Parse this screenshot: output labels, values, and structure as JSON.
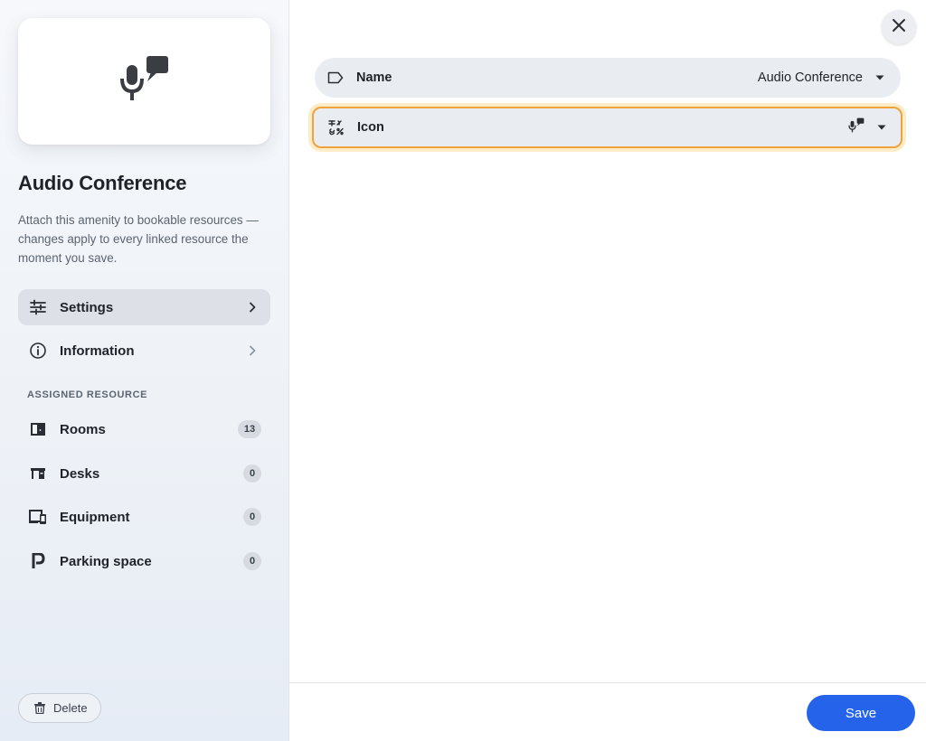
{
  "sidebar": {
    "preview_icon": "microphone-speech-bubble-icon",
    "title": "Audio Conference",
    "description": "Attach this amenity to bookable resources — changes apply to every linked resource the moment you save.",
    "nav": [
      {
        "label": "Settings",
        "icon": "sliders-icon",
        "active": true
      },
      {
        "label": "Information",
        "icon": "info-icon",
        "active": false
      }
    ],
    "section_label": "ASSIGNED RESOURCE",
    "resources": [
      {
        "label": "Rooms",
        "icon": "door-icon",
        "count": "13"
      },
      {
        "label": "Desks",
        "icon": "desk-icon",
        "count": "0"
      },
      {
        "label": "Equipment",
        "icon": "devices-icon",
        "count": "0"
      },
      {
        "label": "Parking space",
        "icon": "parking-icon",
        "count": "0"
      }
    ],
    "delete_label": "Delete"
  },
  "main": {
    "fields": [
      {
        "label": "Name",
        "icon": "label-tag-icon",
        "value": "Audio Conference"
      },
      {
        "label": "Icon",
        "icon": "symbols-icon",
        "value_icon": "microphone-speech-bubble-icon"
      }
    ],
    "save_label": "Save"
  },
  "colors": {
    "accent": "#2563eb",
    "focus_ring": "#f0a33a",
    "active_nav": "#dde1e7",
    "field_bg": "#e9ecf0"
  }
}
